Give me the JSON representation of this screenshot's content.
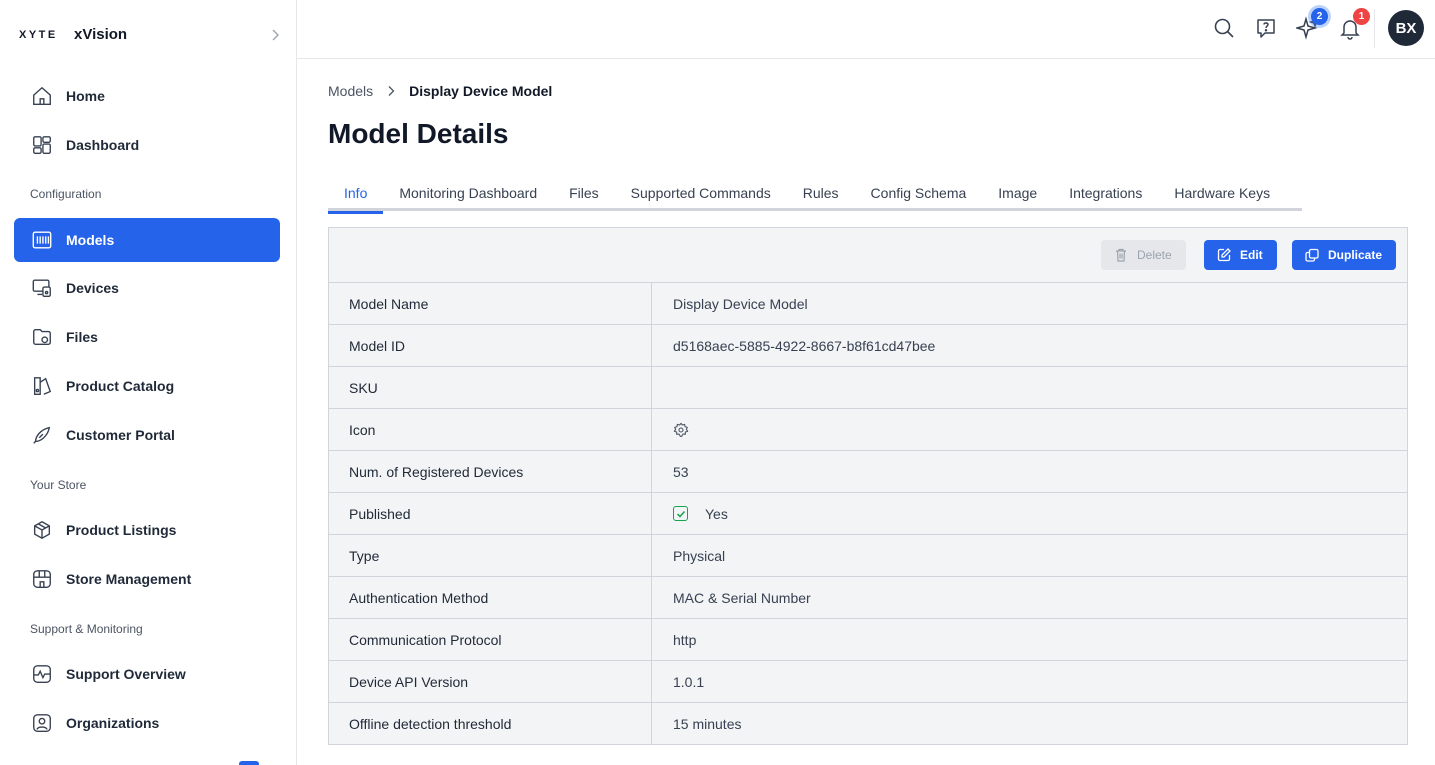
{
  "brand": {
    "logo": "XYTE",
    "org": "xVision"
  },
  "sidebar": {
    "items": [
      {
        "label": "Home",
        "icon": "home-icon"
      },
      {
        "label": "Dashboard",
        "icon": "dashboard-icon"
      },
      {
        "label": "Models",
        "icon": "models-icon",
        "active": true
      },
      {
        "label": "Devices",
        "icon": "devices-icon"
      },
      {
        "label": "Files",
        "icon": "files-icon"
      },
      {
        "label": "Product Catalog",
        "icon": "catalog-icon"
      },
      {
        "label": "Customer Portal",
        "icon": "portal-icon"
      },
      {
        "label": "Product Listings",
        "icon": "box-icon"
      },
      {
        "label": "Store Management",
        "icon": "store-icon"
      },
      {
        "label": "Support Overview",
        "icon": "pulse-icon"
      },
      {
        "label": "Organizations",
        "icon": "organization-icon"
      }
    ],
    "sections": [
      "Configuration",
      "Your Store",
      "Support & Monitoring"
    ]
  },
  "header": {
    "ai_badge": "2",
    "notifications_badge": "1",
    "avatar_initials": "BX"
  },
  "breadcrumb": {
    "parent": "Models",
    "current": "Display Device Model"
  },
  "page_title": "Model Details",
  "tabs": [
    {
      "label": "Info",
      "active": true
    },
    {
      "label": "Monitoring Dashboard"
    },
    {
      "label": "Files"
    },
    {
      "label": "Supported Commands"
    },
    {
      "label": "Rules"
    },
    {
      "label": "Config Schema"
    },
    {
      "label": "Image"
    },
    {
      "label": "Integrations"
    },
    {
      "label": "Hardware Keys"
    }
  ],
  "actions": {
    "delete": "Delete",
    "edit": "Edit",
    "duplicate": "Duplicate"
  },
  "details": [
    {
      "key": "Model Name",
      "value": "Display Device Model"
    },
    {
      "key": "Model ID",
      "value": "d5168aec-5885-4922-8667-b8f61cd47bee"
    },
    {
      "key": "SKU",
      "value": ""
    },
    {
      "key": "Icon",
      "value": "",
      "icon": "gear-icon"
    },
    {
      "key": "Num. of Registered Devices",
      "value": "53"
    },
    {
      "key": "Published",
      "value": "Yes",
      "icon": "checkbox-checked-icon"
    },
    {
      "key": "Type",
      "value": "Physical"
    },
    {
      "key": "Authentication Method",
      "value": "MAC & Serial Number"
    },
    {
      "key": "Communication Protocol",
      "value": "http"
    },
    {
      "key": "Device API Version",
      "value": "1.0.1"
    },
    {
      "key": "Offline detection threshold",
      "value": "15 minutes"
    }
  ],
  "colors": {
    "accent": "#2563eb",
    "danger": "#ef4444",
    "success": "#16a34a"
  }
}
